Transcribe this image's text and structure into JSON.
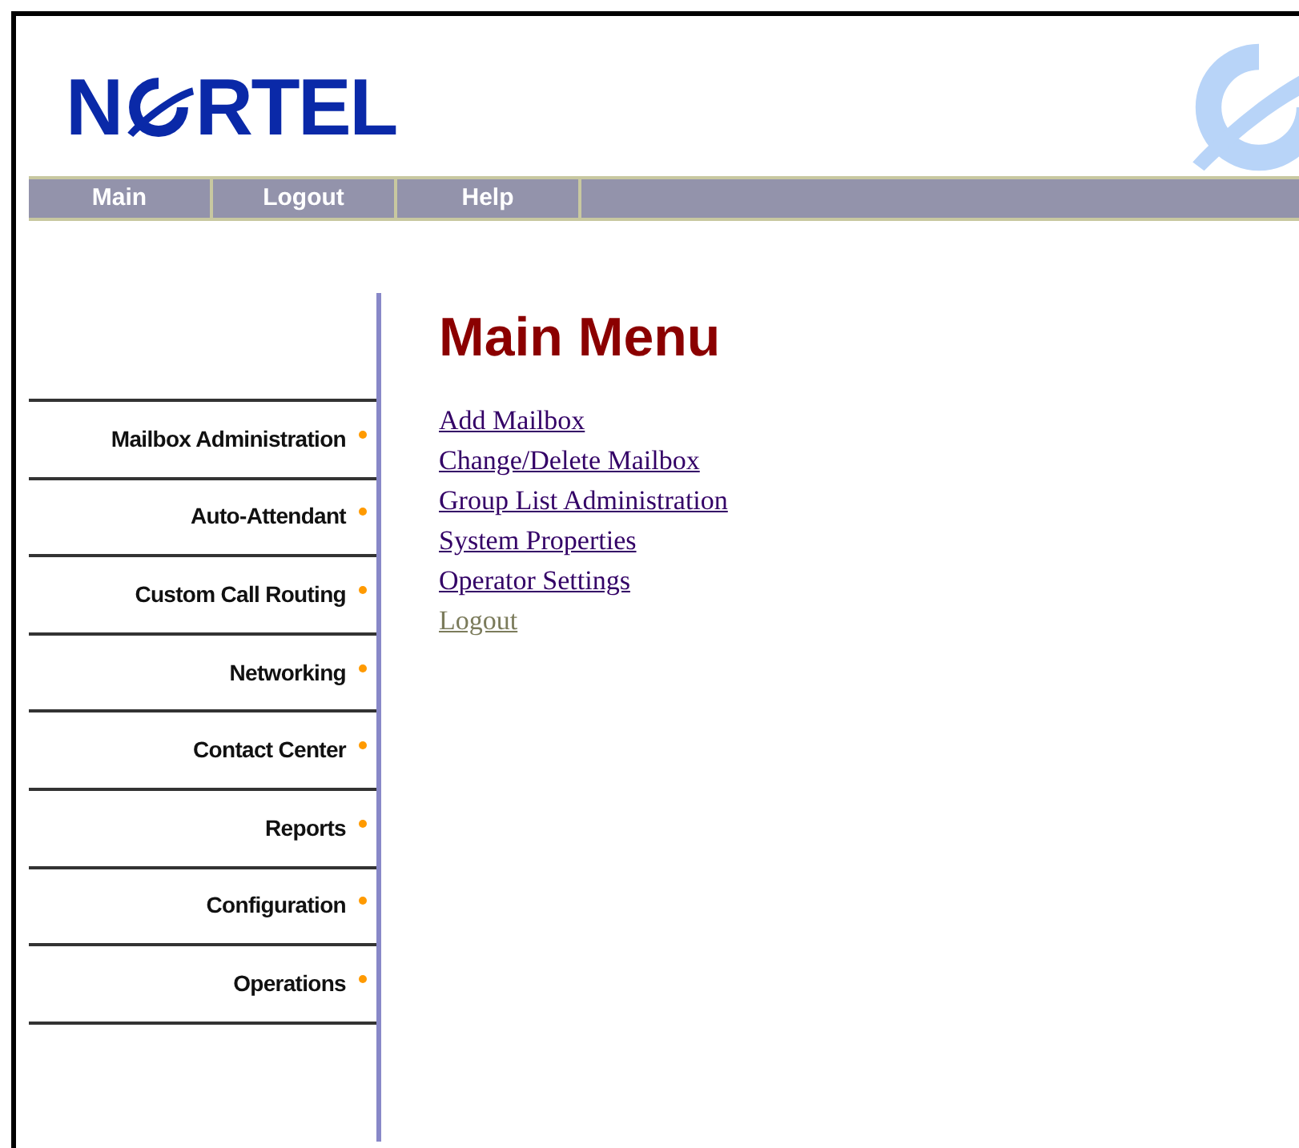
{
  "logo": {
    "text_before": "N",
    "text_after": "RTEL"
  },
  "nav": [
    {
      "label": "Main"
    },
    {
      "label": "Logout"
    },
    {
      "label": "Help"
    }
  ],
  "sidebar": {
    "items": [
      {
        "label": "Mailbox Administration"
      },
      {
        "label": "Auto-Attendant"
      },
      {
        "label": "Custom Call Routing"
      },
      {
        "label": "Networking"
      },
      {
        "label": "Contact Center"
      },
      {
        "label": "Reports"
      },
      {
        "label": "Configuration"
      },
      {
        "label": "Operations"
      }
    ]
  },
  "main": {
    "title": "Main Menu",
    "links": [
      {
        "label": "Add Mailbox",
        "visited": false
      },
      {
        "label": "Change/Delete Mailbox",
        "visited": false
      },
      {
        "label": "Group List Administration",
        "visited": false
      },
      {
        "label": "System Properties",
        "visited": false
      },
      {
        "label": "Operator Settings",
        "visited": false
      },
      {
        "label": "Logout",
        "visited": true
      }
    ]
  }
}
